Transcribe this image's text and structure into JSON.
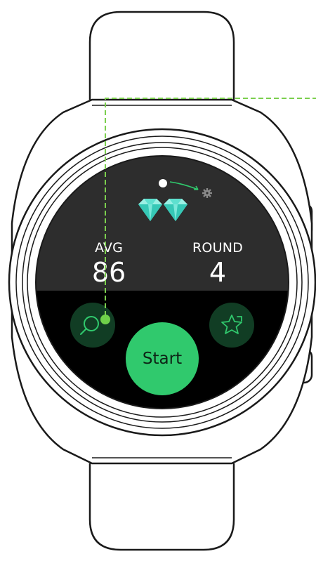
{
  "screen": {
    "stats": {
      "avg_label": "AVG",
      "avg_value": "86",
      "round_label": "ROUND",
      "round_value": "4"
    },
    "start_label": "Start",
    "page_indicator": {
      "current_page": 1,
      "next_page_icon": "gear-icon"
    },
    "gems": {
      "count": 2,
      "icon": "diamond-icon",
      "color": "#5ee0cf"
    },
    "buttons": {
      "search_icon": "search-icon",
      "favorite_icon": "star-arrow-icon"
    }
  },
  "colors": {
    "accent": "#30c96d",
    "button_dark": "#113d24",
    "callout_line": "#7bcf4e",
    "screen_top": "#2d2d2d",
    "screen_bottom": "#000000"
  }
}
